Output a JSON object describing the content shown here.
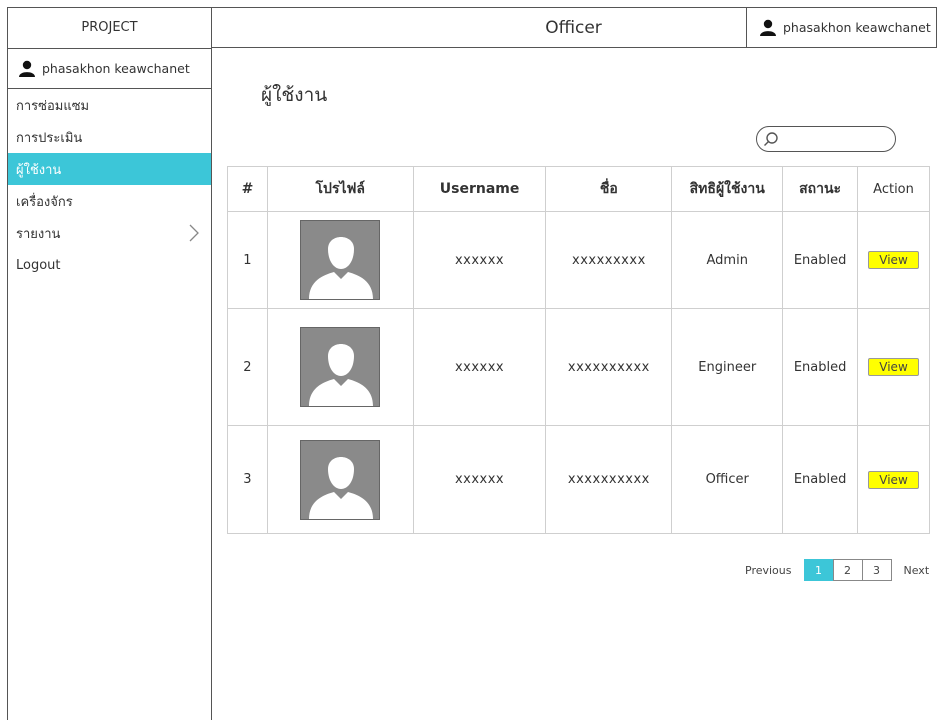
{
  "sidebar": {
    "project_title": "PROJECT",
    "user_name": "phasakhon keawchanet",
    "items": [
      {
        "label": "การซ่อมแซม"
      },
      {
        "label": "การประเมิน"
      },
      {
        "label": "ผู้ใช้งาน",
        "active": true
      },
      {
        "label": "เครื่องจักร"
      },
      {
        "label": "รายงาน",
        "has_submenu": true
      },
      {
        "label": "Logout"
      }
    ]
  },
  "header": {
    "title": "Officer",
    "user_name": "phasakhon keawchanet"
  },
  "main": {
    "page_title": "ผู้ใช้งาน",
    "search": {
      "value": "",
      "placeholder": ""
    },
    "table": {
      "columns": [
        "#",
        "โปรไฟล์",
        "Username",
        "ชื่อ",
        "สิทธิผู้ใช้งาน",
        "สถานะ",
        "Action"
      ],
      "rows": [
        {
          "num": "1",
          "username": "xxxxxx",
          "name": "xxxxxxxxx",
          "role": "Admin",
          "status": "Enabled",
          "action": "View"
        },
        {
          "num": "2",
          "username": "xxxxxx",
          "name": "xxxxxxxxxx",
          "role": "Engineer",
          "status": "Enabled",
          "action": "View"
        },
        {
          "num": "3",
          "username": "xxxxxx",
          "name": "xxxxxxxxxx",
          "role": "Officer",
          "status": "Enabled",
          "action": "View"
        }
      ]
    },
    "pagination": {
      "previous": "Previous",
      "pages": [
        "1",
        "2",
        "3"
      ],
      "current_page": "1",
      "next": "Next"
    }
  },
  "colors": {
    "accent": "#3cc6d8",
    "view_button": "#ffff00",
    "avatar_bg": "#8a8a8a"
  },
  "icons": {
    "user": "person-icon",
    "search": "search-icon",
    "submenu": "chevron-right-icon",
    "avatar": "avatar-placeholder"
  }
}
